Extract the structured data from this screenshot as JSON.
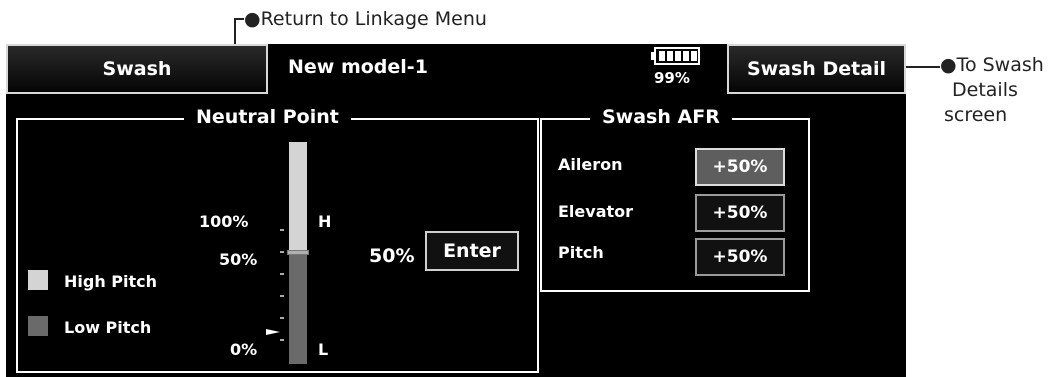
{
  "annotations": {
    "return_link": "●Return to Linkage Menu",
    "to_detail_line1": "●To Swash",
    "to_detail_line2": "Details",
    "to_detail_line3": "screen"
  },
  "header": {
    "swash_button": "Swash",
    "model_name": "New model-1",
    "battery_icon": "battery-icon",
    "battery_percent": "99%",
    "detail_button": "Swash Detail"
  },
  "neutral_point": {
    "title": "Neutral Point",
    "label_100": "100%",
    "label_50": "50%",
    "label_0": "0%",
    "label_high": "H",
    "label_low": "L",
    "value_display": "50%",
    "neutral_level": 0.5,
    "enter_button": "Enter",
    "legend": [
      {
        "label": "High Pitch",
        "color": "#d4d4d4"
      },
      {
        "label": "Low Pitch",
        "color": "#6a6a6a"
      }
    ]
  },
  "swash_afr": {
    "title": "Swash AFR",
    "rows": [
      {
        "label": "Aileron",
        "value": "+50%",
        "active": true
      },
      {
        "label": "Elevator",
        "value": "+50%",
        "active": false
      },
      {
        "label": "Pitch",
        "value": "+50%",
        "active": false
      }
    ]
  }
}
